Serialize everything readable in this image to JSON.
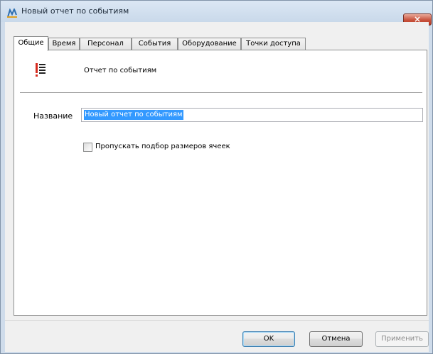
{
  "window": {
    "title": "Новый отчет по событиям",
    "close_label": "×"
  },
  "tabs": [
    {
      "label": "Общие",
      "active": true
    },
    {
      "label": "Время",
      "active": false
    },
    {
      "label": "Персонал",
      "active": false
    },
    {
      "label": "События",
      "active": false
    },
    {
      "label": "Оборудование",
      "active": false
    },
    {
      "label": "Точки доступа",
      "active": false
    }
  ],
  "report": {
    "type_label": "Отчет по событиям",
    "icon": "report-list-icon"
  },
  "form": {
    "name_label": "Название",
    "name_value": "Новый отчет по событиям",
    "skip_resize_label": "Пропускать подбор размеров ячеек",
    "skip_resize_checked": false
  },
  "buttons": {
    "ok": "OK",
    "cancel": "Отмена",
    "apply": "Применить"
  },
  "colors": {
    "accent_red": "#c0392b",
    "selection": "#3399ff"
  }
}
